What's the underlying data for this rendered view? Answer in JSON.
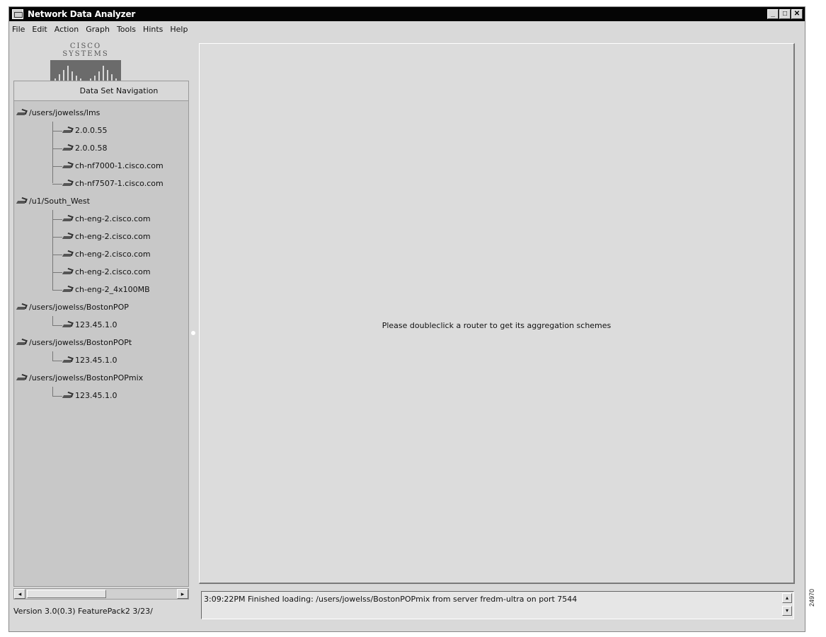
{
  "window": {
    "title": "Network Data Analyzer",
    "controls": {
      "minimize": "_",
      "maximize": "□",
      "close": "✕"
    }
  },
  "menubar": [
    "File",
    "Edit",
    "Action",
    "Graph",
    "Tools",
    "Hints",
    "Help"
  ],
  "logo": {
    "text": "CISCO SYSTEMS"
  },
  "navigation": {
    "header": "Data Set Navigation",
    "groups": [
      {
        "label": "/users/jowelss/lms",
        "children": [
          "2.0.0.55",
          "2.0.0.58",
          "ch-nf7000-1.cisco.com",
          "ch-nf7507-1.cisco.com"
        ]
      },
      {
        "label": "/u1/South_West",
        "children": [
          "ch-eng-2.cisco.com",
          "ch-eng-2.cisco.com",
          "ch-eng-2.cisco.com",
          "ch-eng-2.cisco.com",
          "ch-eng-2_4x100MB"
        ]
      },
      {
        "label": "/users/jowelss/BostonPOP",
        "children": [
          "123.45.1.0"
        ]
      },
      {
        "label": "/users/jowelss/BostonPOPt",
        "children": [
          "123.45.1.0"
        ]
      },
      {
        "label": "/users/jowelss/BostonPOPmix",
        "children": [
          "123.45.1.0"
        ]
      }
    ],
    "scroll_left": "◂",
    "scroll_right": "▸"
  },
  "version": "Version 3.0(0.3) FeaturePack2 3/23/",
  "main": {
    "message": "Please doubleclick a router to get its aggregation schemes"
  },
  "status": {
    "text": "3:09:22PM   Finished loading: /users/jowelss/BostonPOPmix from server fredm-ultra on port 7544",
    "scroll_up": "▴",
    "scroll_down": "▾"
  },
  "figure_id": "24970"
}
